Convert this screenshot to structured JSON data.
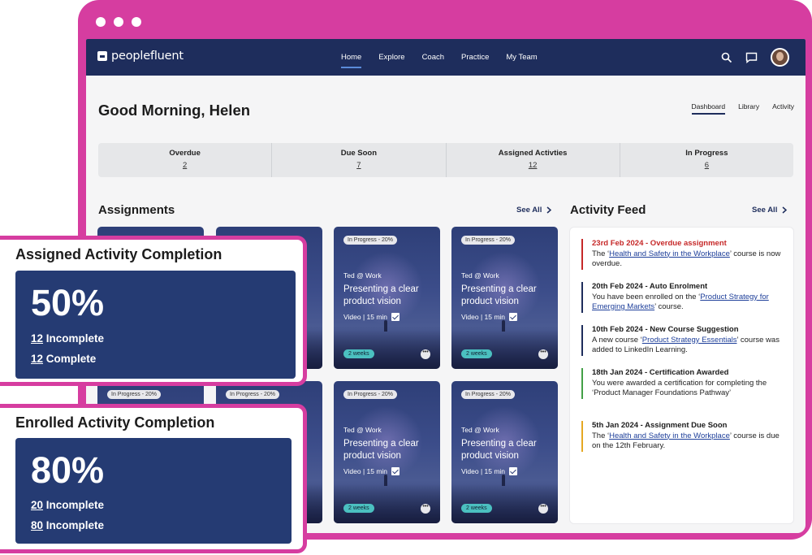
{
  "app": {
    "logo": "peoplefluent"
  },
  "nav": [
    "Home",
    "Explore",
    "Coach",
    "Practice",
    "My Team"
  ],
  "greeting": "Good Morning, Helen",
  "subnav": [
    "Dashboard",
    "Library",
    "Activity"
  ],
  "stats": [
    {
      "label": "Overdue",
      "value": "2"
    },
    {
      "label": "Due Soon",
      "value": "7"
    },
    {
      "label": "Assigned Activties",
      "value": "12"
    },
    {
      "label": "In Progress",
      "value": "6"
    }
  ],
  "assignments": {
    "title": "Assignments",
    "see_all": "See All",
    "card": {
      "badge": "In Progress - 20%",
      "sub": "Ted @ Work",
      "title": "Presenting a clear product vision",
      "meta": "Video | 15 min",
      "duration": "2 weeks",
      "more": "•••"
    }
  },
  "feed": {
    "title": "Activity Feed",
    "see_all": "See All",
    "items": [
      {
        "head": "23rd Feb 2024 - Overdue assignment",
        "pre": "The ‘",
        "link": "Health and Safety in the Workplace",
        "post": "’ course is now overdue."
      },
      {
        "head": "20th Feb 2024 - Auto Enrolment",
        "pre": "You have been enrolled on the ‘",
        "link": "Product Strategy for Emerging Markets",
        "post": "’ course."
      },
      {
        "head": "10th Feb 2024 - New Course Suggestion",
        "pre": "A new course ‘",
        "link": "Product Strategy Essentials",
        "post": "’ course was added to LinkedIn Learning."
      },
      {
        "head": "18th Jan 2024 - Certification Awarded",
        "pre": "You were awarded a certification for completing the ‘Product Manager Foundations Pathway’",
        "link": "",
        "post": ""
      },
      {
        "head": "5th Jan 2024 - Assignment Due Soon",
        "pre": "The ‘",
        "link": "Health and Safety in the Workplace",
        "post": "’ course is due on the 12th February."
      }
    ]
  },
  "overlays": [
    {
      "title": "Assigned Activity Completion",
      "percent": "50%",
      "line1_num": "12",
      "line1_text": " Incomplete",
      "line2_num": "12",
      "line2_text": " Complete"
    },
    {
      "title": "Enrolled Activity Completion",
      "percent": "80%",
      "line1_num": "20",
      "line1_text": " Incomplete",
      "line2_num": "80",
      "line2_text": " Incomplete"
    }
  ],
  "colors": {
    "brand_navy": "#1e2d5c",
    "frame_pink": "#d63da0",
    "teal_badge": "#4bc0c0",
    "overdue_red": "#c62828"
  },
  "icons": {
    "search": "search-icon",
    "chat": "chat-icon",
    "avatar": "avatar",
    "chevron": "chevron-right-icon",
    "check": "checkbox-icon"
  }
}
